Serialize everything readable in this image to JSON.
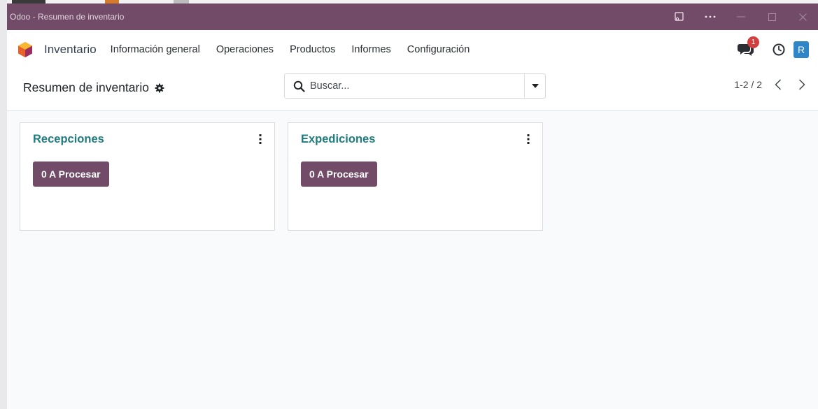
{
  "window": {
    "title": "Odoo - Resumen de inventario"
  },
  "navbar": {
    "app_name": "Inventario",
    "menu": [
      "Información general",
      "Operaciones",
      "Productos",
      "Informes",
      "Configuración"
    ],
    "messages_badge": "1",
    "avatar_initial": "R",
    "icons": [
      "chat-icon",
      "clock-icon"
    ]
  },
  "control_panel": {
    "breadcrumb": "Resumen de inventario",
    "search_placeholder": "Buscar...",
    "pager": "1-2 / 2"
  },
  "cards": [
    {
      "title": "Recepciones",
      "button": "0 A Procesar"
    },
    {
      "title": "Expediciones",
      "button": "0 A Procesar"
    }
  ],
  "colors": {
    "brand": "#714b67",
    "title_teal": "#1e7c7e",
    "badge_red": "#d23f3f",
    "avatar_blue": "#2e86c9"
  }
}
